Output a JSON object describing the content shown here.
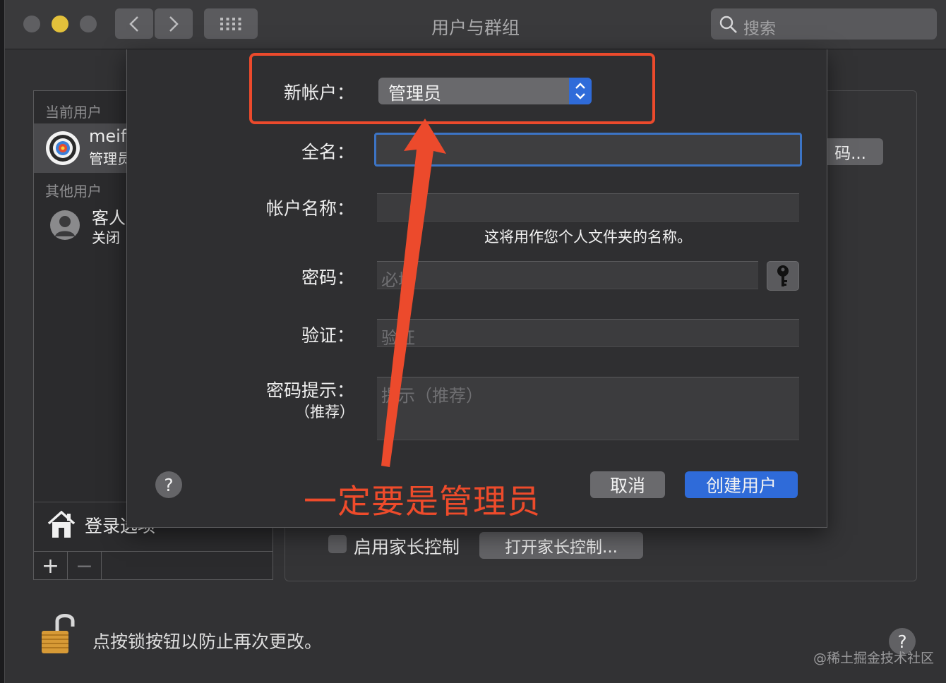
{
  "window": {
    "title": "用户与群组",
    "search_placeholder": "搜索"
  },
  "sidebar": {
    "current_users_header": "当前用户",
    "current_user": {
      "name": "meif",
      "role": "管理员"
    },
    "other_users_header": "其他用户",
    "guest_user": {
      "name": "客人",
      "status": "关闭"
    },
    "login_options_label": "登录选项",
    "add_label": "+",
    "remove_label": "−"
  },
  "background_panel": {
    "password_button": "码...",
    "parental_checkbox_label": "启用家长控制",
    "parental_checkbox_checked": false,
    "open_parental_button": "打开家长控制..."
  },
  "footer": {
    "lock_text": "点按锁按钮以防止再次更改。",
    "help_label": "?"
  },
  "sheet": {
    "new_account_label": "新帐户：",
    "new_account_value": "管理员",
    "full_name_label": "全名：",
    "full_name_value": "",
    "account_name_label": "帐户名称：",
    "account_name_value": "",
    "account_name_note": "这将用作您个人文件夹的名称。",
    "password_label": "密码：",
    "password_placeholder": "必填",
    "verify_label": "验证：",
    "verify_placeholder": "验证",
    "hint_label": "密码提示：",
    "hint_label_sub": "（推荐）",
    "hint_placeholder": "提示（推荐）",
    "help_label": "?",
    "cancel_button": "取消",
    "create_button": "创建用户"
  },
  "annotation": {
    "text": "一定要是管理员",
    "color": "#ee4b2b"
  },
  "watermark": "@稀土掘金技术社区",
  "colors": {
    "accent_blue": "#2f6bd9",
    "annotation_red": "#ec4a2c"
  }
}
